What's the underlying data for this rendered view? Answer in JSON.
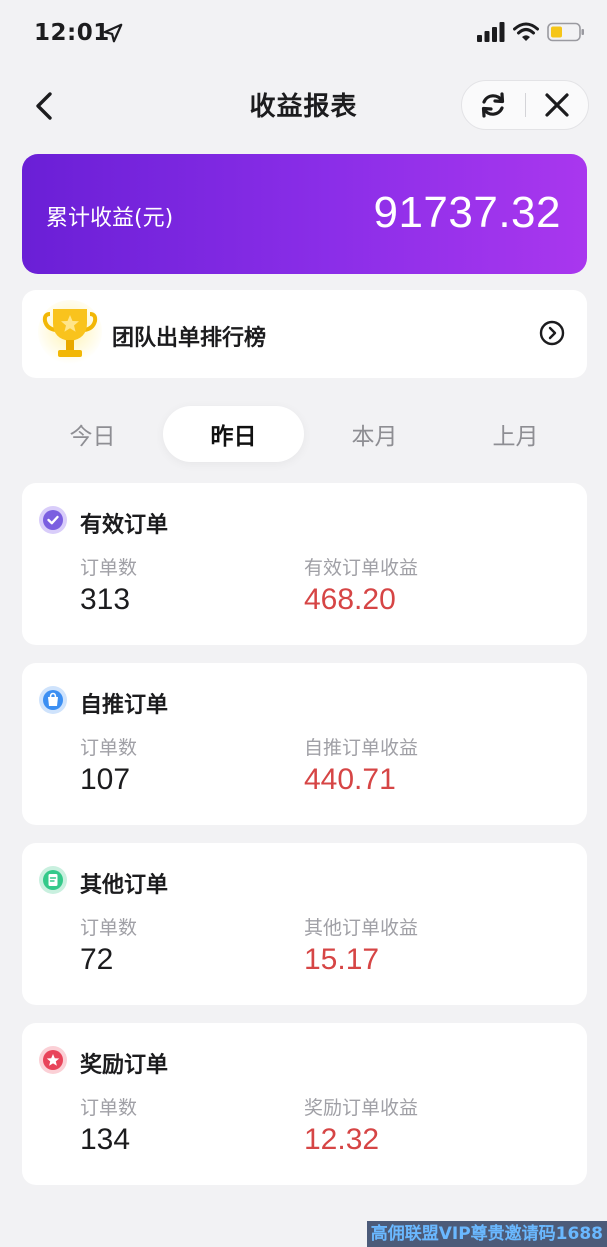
{
  "status_bar": {
    "time": "12:01",
    "icons": [
      "location-arrow-icon",
      "signal-icon",
      "wifi-icon",
      "battery-icon"
    ]
  },
  "nav": {
    "title": "收益报表",
    "icons": [
      "back-chevron-icon",
      "refresh-icon",
      "close-icon"
    ]
  },
  "total": {
    "label": "累计收益(元)",
    "value": "91737.32",
    "gradient": [
      "#6a1fd6",
      "#a937ee"
    ]
  },
  "ranking": {
    "label": "团队出单排行榜",
    "icons": [
      "trophy-icon",
      "circle-chevron-right-icon"
    ]
  },
  "tabs": [
    {
      "label": "今日",
      "active": false
    },
    {
      "label": "昨日",
      "active": true
    },
    {
      "label": "本月",
      "active": false
    },
    {
      "label": "上月",
      "active": false
    }
  ],
  "orders": [
    {
      "title": "有效订单",
      "count_label": "订单数",
      "count": "313",
      "income_label": "有效订单收益",
      "income": "468.20",
      "icon": "check-badge-icon",
      "icon_color": "#7b5fe0"
    },
    {
      "title": "自推订单",
      "count_label": "订单数",
      "count": "107",
      "income_label": "自推订单收益",
      "income": "440.71",
      "icon": "shopping-bag-icon",
      "icon_color": "#3c8ff2"
    },
    {
      "title": "其他订单",
      "count_label": "订单数",
      "count": "72",
      "income_label": "其他订单收益",
      "income": "15.17",
      "icon": "document-icon",
      "icon_color": "#34c98a"
    },
    {
      "title": "奖励订单",
      "count_label": "订单数",
      "count": "134",
      "income_label": "奖励订单收益",
      "income": "12.32",
      "icon": "star-badge-icon",
      "icon_color": "#e8445a"
    }
  ],
  "colors": {
    "income": "#d64545",
    "background": "#f2f2f4"
  },
  "watermark": "高佣联盟VIP尊贵邀请码1688"
}
